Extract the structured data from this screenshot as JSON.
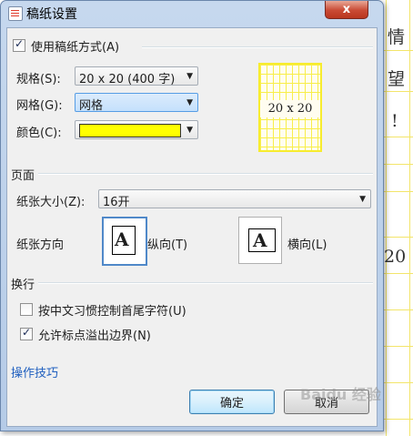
{
  "background": {
    "chars": [
      "情",
      "望",
      "!",
      "20"
    ]
  },
  "dialog": {
    "title": "稿纸设置",
    "close_label": "x"
  },
  "use_grid_paper": {
    "label": "使用稿纸方式(A)",
    "checked": true
  },
  "spec": {
    "label": "规格(S):",
    "value": "20 x 20 (400 字)"
  },
  "grid": {
    "label": "网格(G):",
    "value": "网格"
  },
  "color": {
    "label": "颜色(C):",
    "value": "#ffff00"
  },
  "preview": {
    "text": "20 x 20"
  },
  "page_section": {
    "title": "页面",
    "paper_size_label": "纸张大小(Z):",
    "paper_size_value": "16开",
    "orientation_label": "纸张方向",
    "portrait_label": "纵向(T)",
    "landscape_label": "横向(L)",
    "orientation_glyph": "A"
  },
  "linebreak_section": {
    "title": "换行",
    "option1": {
      "label": "按中文习惯控制首尾字符(U)",
      "checked": false
    },
    "option2": {
      "label": "允许标点溢出边界(N)",
      "checked": true
    }
  },
  "tips_link": "操作技巧",
  "buttons": {
    "ok": "确定",
    "cancel": "取消"
  },
  "watermark": "Baidu 经验"
}
